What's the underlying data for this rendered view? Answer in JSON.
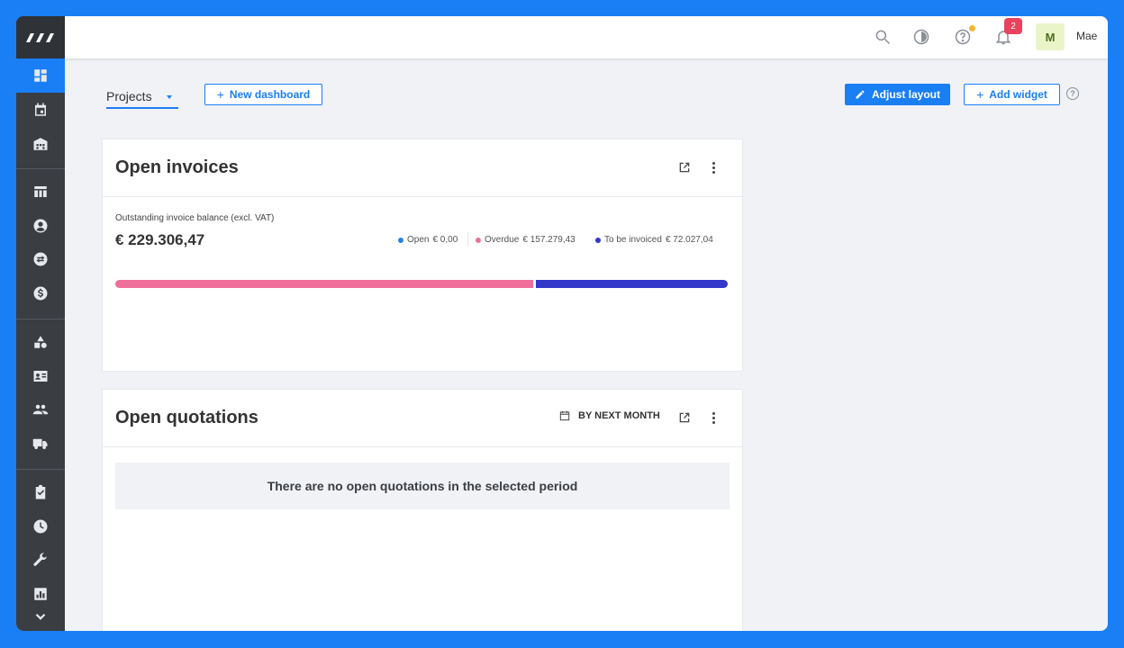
{
  "app": {
    "nav_items": [
      "dashboard",
      "calendar",
      "warehouse",
      "table",
      "contact",
      "exchange",
      "dollar",
      "shapes",
      "id-card",
      "team",
      "truck",
      "tasks",
      "clock",
      "tools",
      "report",
      "expand"
    ]
  },
  "topbar": {
    "notification_count": "2",
    "avatar_initial": "M",
    "username": "Mae"
  },
  "toolbar": {
    "dashboard_select": "Projects",
    "new_dashboard_label": "New dashboard",
    "adjust_layout_label": "Adjust layout",
    "add_widget_label": "Add widget",
    "help_glyph": "?"
  },
  "invoices_card": {
    "title": "Open invoices",
    "subtitle": "Outstanding invoice balance (excl. VAT)",
    "total": "€ 229.306,47",
    "legend": [
      {
        "label": "Open",
        "amount": "€ 0,00",
        "color": "#2a7fe8",
        "value": 0
      },
      {
        "label": "Overdue",
        "amount": "€ 157.279,43",
        "color": "#ee6f99",
        "value": 157279.43
      },
      {
        "label": "To be invoiced",
        "amount": "€ 72.027,04",
        "color": "#3338c9",
        "value": 72027.04
      }
    ]
  },
  "quotations_card": {
    "title": "Open quotations",
    "period_label": "BY NEXT MONTH",
    "empty_message": "There are no open quotations in the selected period"
  },
  "colors": {
    "accent": "#1a7ef5",
    "sidebar": "#3a3d42",
    "overdue": "#ee6f99",
    "to_be_invoiced": "#3338c9"
  }
}
